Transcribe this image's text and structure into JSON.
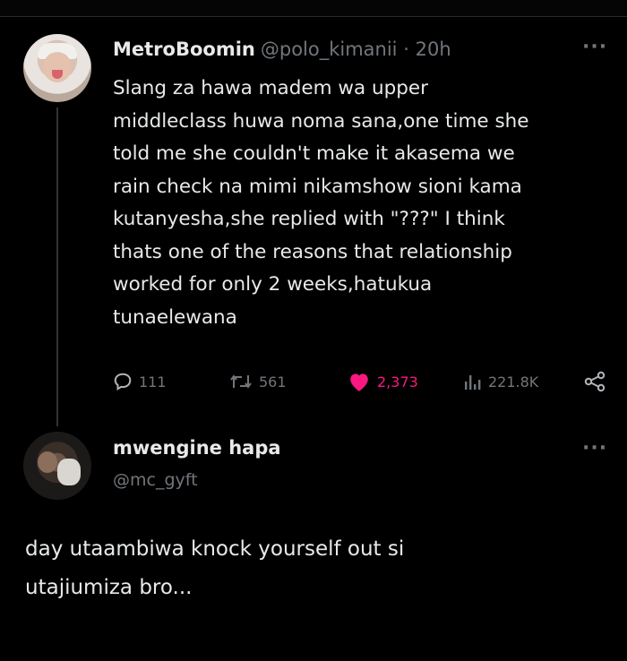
{
  "tweet1": {
    "display_name": "MetroBoomin",
    "handle": "@polo_kimanii",
    "separator": "·",
    "time": "20h",
    "text": "Slang za hawa madem wa upper\nmiddleclass huwa noma sana,one time she\ntold me she couldn't make it akasema we\nrain check na mimi nikamshow sioni kama\nkutanyesha,she replied with \"???\"  I think\nthats one of the reasons that relationship\nworked for only 2 weeks,hatukua\ntunaelewana",
    "stats": {
      "replies": "111",
      "retweets": "561",
      "likes": "2,373",
      "views": "221.8K"
    },
    "icons": {
      "reply": "reply-icon",
      "retweet": "retweet-icon",
      "like": "heart-icon",
      "views": "views-icon",
      "share": "share-icon",
      "more": "more-icon"
    }
  },
  "tweet2": {
    "display_name": "mwengine hapa",
    "handle": "@mc_gyft",
    "text": "day utaambiwa knock yourself out si\nutajiumiza bro..."
  },
  "colors": {
    "background": "#000000",
    "text": "#e7e9ea",
    "muted": "#71767b",
    "like": "#f91880"
  }
}
